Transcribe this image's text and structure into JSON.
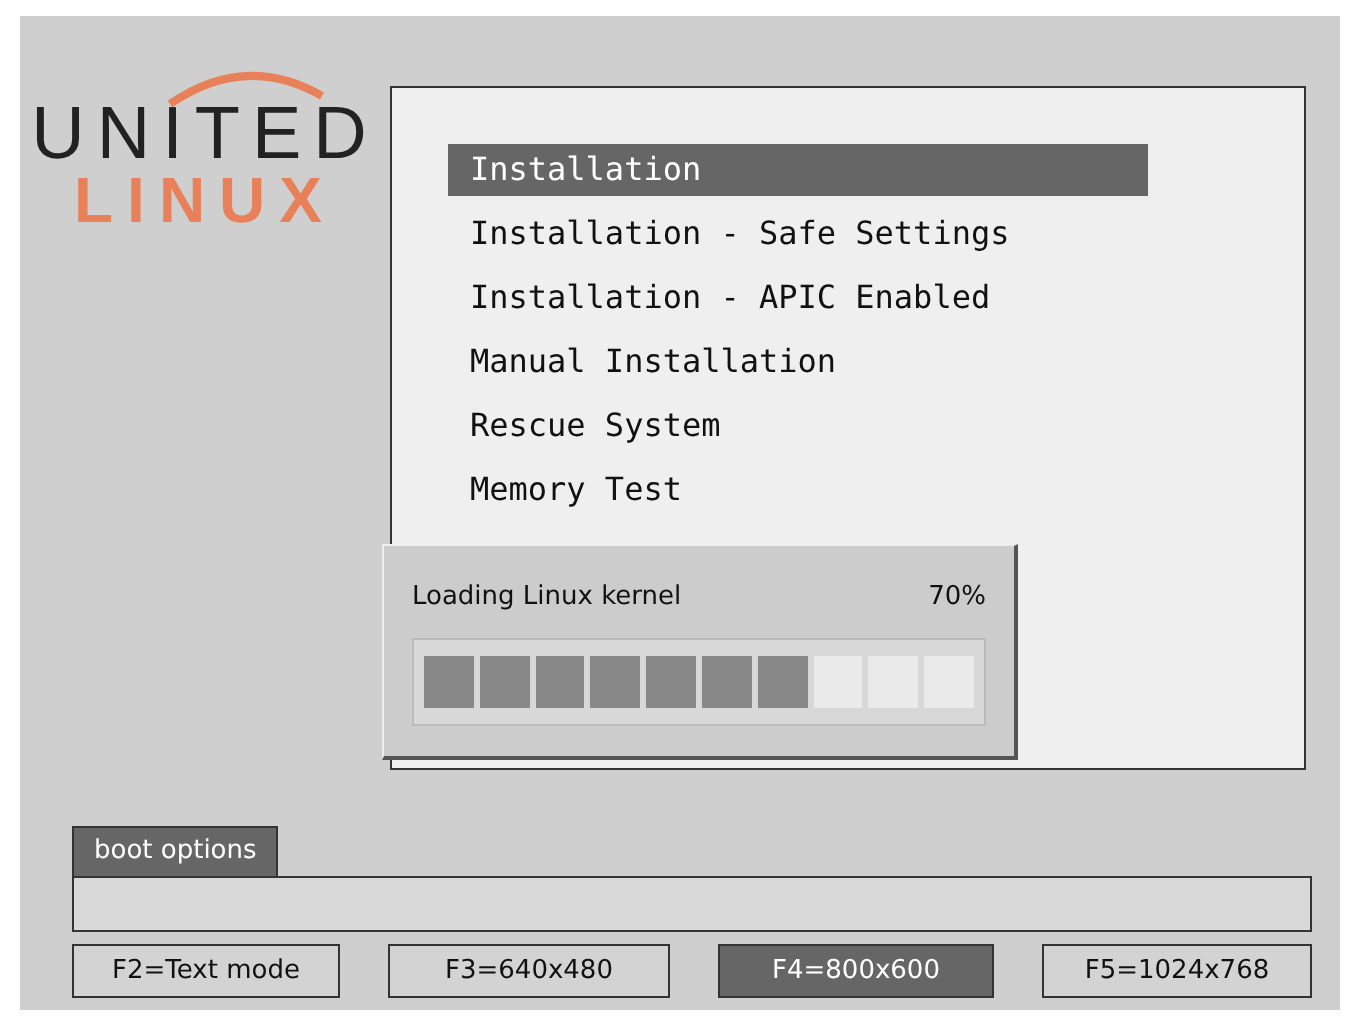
{
  "logo": {
    "line_1": "UNITED",
    "line_2": "LINUX"
  },
  "menu": {
    "items": [
      {
        "label": "Installation",
        "selected": true
      },
      {
        "label": "Installation - Safe Settings",
        "selected": false
      },
      {
        "label": "Installation - APIC Enabled",
        "selected": false
      },
      {
        "label": "Manual Installation",
        "selected": false
      },
      {
        "label": "Rescue System",
        "selected": false
      },
      {
        "label": "Memory Test",
        "selected": false
      }
    ]
  },
  "progress_dialog": {
    "message": "Loading Linux kernel",
    "percent": "70%",
    "level": 0.7
  },
  "boot_options": {
    "label": "boot options"
  },
  "function_keys": [
    {
      "label": "F2=Text mode",
      "selected": false
    },
    {
      "label": "F3=640x480",
      "selected": false
    },
    {
      "label": "F4=800x600",
      "selected": true
    },
    {
      "label": "F5=1024x768",
      "selected": false
    }
  ]
}
